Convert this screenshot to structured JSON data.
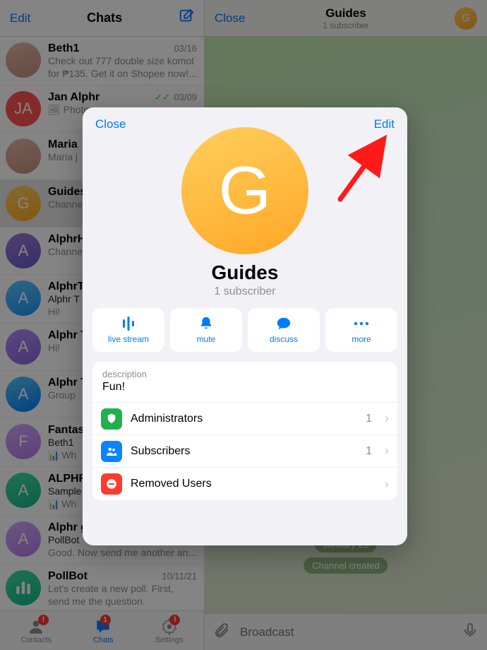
{
  "sidebar": {
    "edit": "Edit",
    "title": "Chats",
    "chats": [
      {
        "name": "Beth1",
        "date": "03/16",
        "preview": "Check out 777 double size komot for ₱135. Get it on Shopee now!...",
        "avatarColor": "#d9a3a0",
        "initials": "",
        "img": true
      },
      {
        "name": "Jan Alphr",
        "date": "03/09",
        "preview": "Photo",
        "avatarColor": "#ff5252",
        "initials": "JA",
        "checks": true,
        "photoIcon": true
      },
      {
        "name": "Maria",
        "date": "",
        "preview": "Maria j",
        "avatarColor": "#e0c7b8",
        "initials": "",
        "img": true
      },
      {
        "name": "Guides",
        "date": "",
        "preview": "Channel",
        "avatarColor": "linear-gradient(160deg,#ffcf5c,#ffa726)",
        "initials": "G",
        "selected": true
      },
      {
        "name": "AlphrH",
        "date": "",
        "preview": "Channel",
        "avatarColor": "linear-gradient(160deg,#9b7bd6,#6a5acd)",
        "initials": "A"
      },
      {
        "name": "AlphrT",
        "date": "",
        "preview": "Hi!",
        "prefix": "Alphr T",
        "avatarColor": "linear-gradient(160deg,#5ac8fa,#1e90ff)",
        "initials": "A"
      },
      {
        "name": "Alphr T",
        "date": "",
        "preview": "Hi!",
        "avatarColor": "linear-gradient(160deg,#b18cff,#8a63d2)",
        "initials": "A"
      },
      {
        "name": "Alphr T",
        "date": "",
        "preview": "Group",
        "avatarColor": "linear-gradient(160deg,#5ac8fa,#007aff)",
        "initials": "A"
      },
      {
        "name": "Fantas",
        "date": "",
        "preview": "Wh",
        "prefix": "Beth1",
        "chart": true,
        "avatarColor": "linear-gradient(160deg,#d2a6ff,#b07be5)",
        "initials": "F"
      },
      {
        "name": "ALPHR",
        "date": "",
        "preview": "Wh",
        "prefix": "Sample",
        "chart": true,
        "avatarColor": "linear-gradient(160deg,#3ddc97,#17b890)",
        "initials": "A"
      },
      {
        "name": "Alphr g",
        "date": "",
        "preview": "Good. Now send me another an...",
        "prefix": "PollBot",
        "avatarColor": "linear-gradient(160deg,#d2a6ff,#b07be5)",
        "initials": "A"
      },
      {
        "name": "PollBot",
        "date": "10/11/21",
        "preview": "Let's create a new poll. First, send me the question.",
        "avatarColor": "linear-gradient(160deg,#3ddc97,#17b890)",
        "initials": "",
        "pollIcon": true
      }
    ],
    "tabs": {
      "contacts": "Contacts",
      "chats": "Chats",
      "settings": "Settings",
      "badge_chats": "1",
      "badge_alert": "!"
    }
  },
  "main": {
    "close": "Close",
    "title": "Guides",
    "sub": "1 subscriber",
    "avatar_initial": "G",
    "date_pill": "January 21",
    "sys_pill": "Channel created",
    "compose_placeholder": "Broadcast"
  },
  "modal": {
    "close": "Close",
    "edit": "Edit",
    "avatar_initial": "G",
    "name": "Guides",
    "sub": "1 subscriber",
    "actions": {
      "live": "live stream",
      "mute": "mute",
      "discuss": "discuss",
      "more": "more"
    },
    "desc_label": "description",
    "desc_value": "Fun!",
    "rows": [
      {
        "label": "Administrators",
        "count": "1",
        "color": "#1fb24a",
        "icon": "shield"
      },
      {
        "label": "Subscribers",
        "count": "1",
        "color": "#0a84ff",
        "icon": "people"
      },
      {
        "label": "Removed Users",
        "count": "",
        "color": "#ff3b30",
        "icon": "removed"
      }
    ]
  }
}
